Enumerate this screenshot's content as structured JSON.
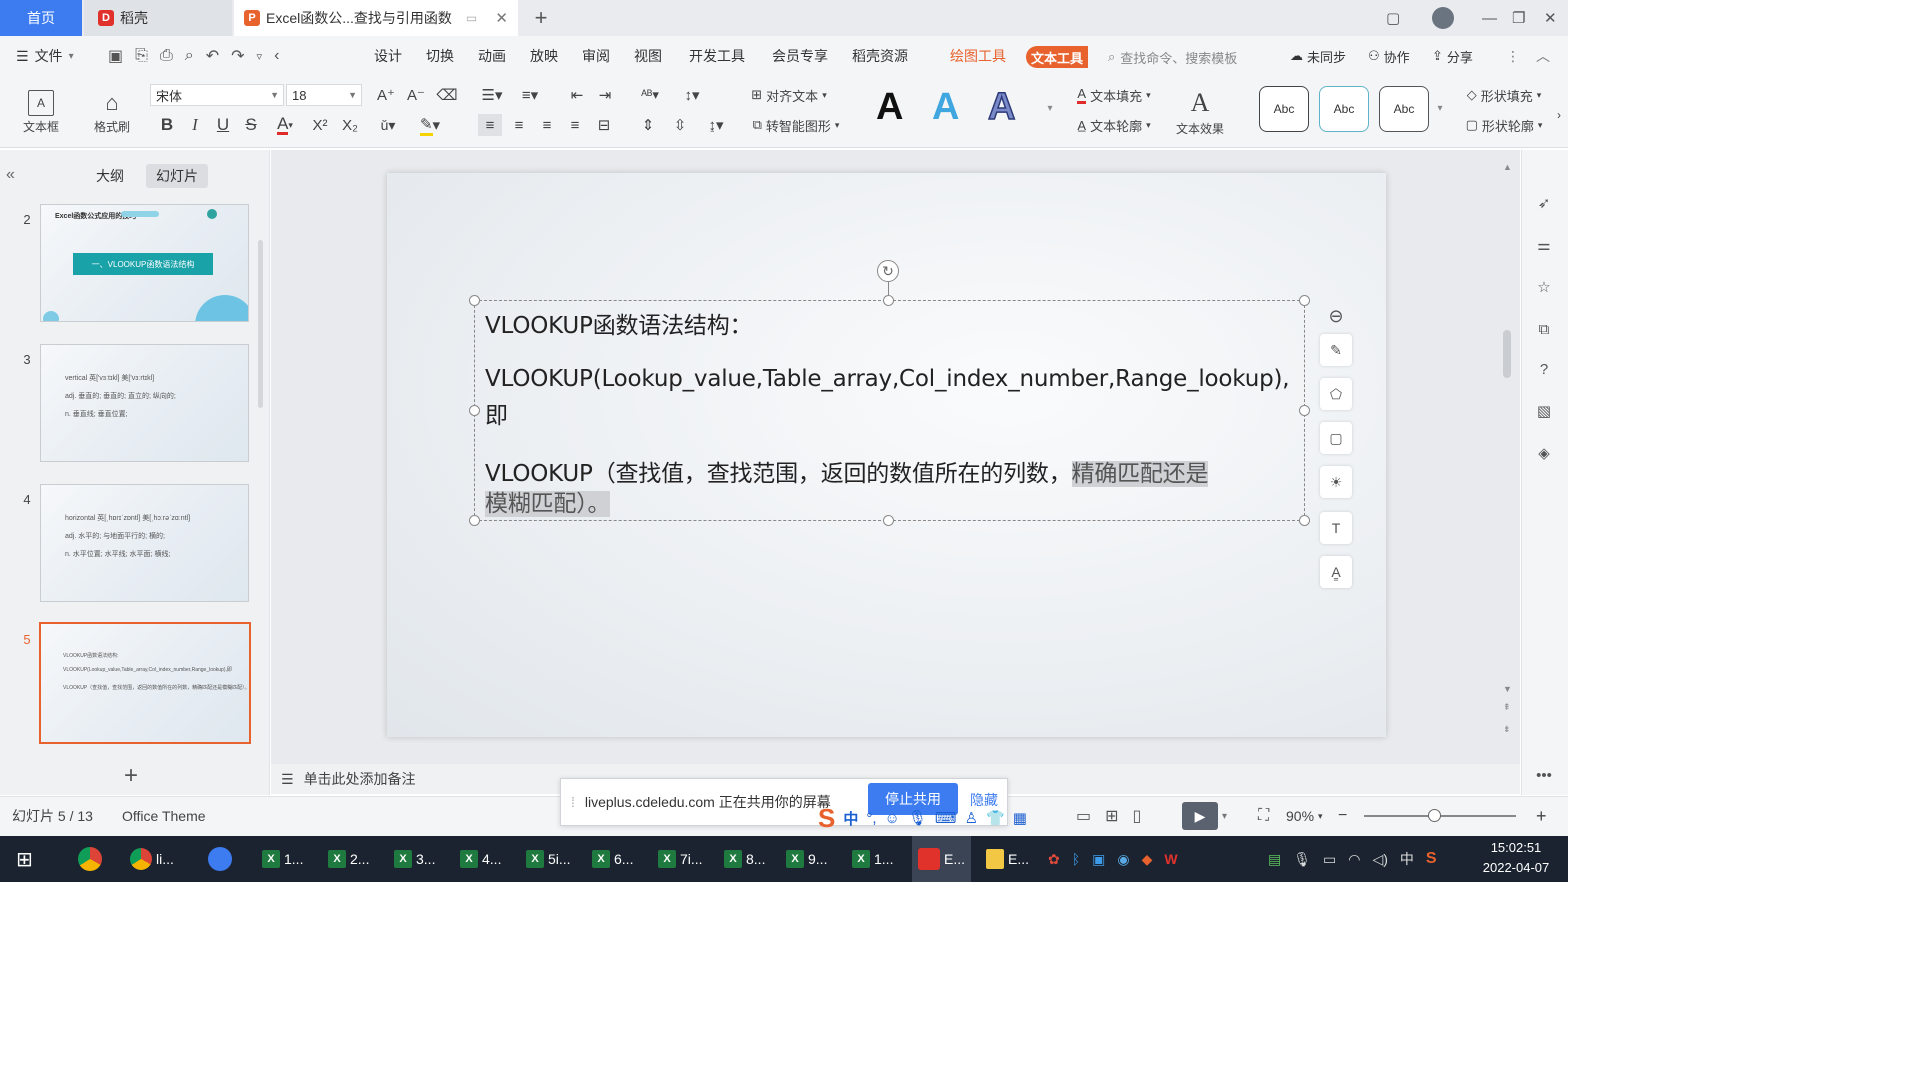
{
  "tabs": {
    "home": "首页",
    "daoke": "稻壳",
    "doc": "Excel函数公...查找与引用函数"
  },
  "menu": {
    "file": "文件",
    "items": [
      "设计",
      "切换",
      "动画",
      "放映",
      "审阅",
      "视图",
      "开发工具",
      "会员专享",
      "稻壳资源"
    ],
    "drawing_tools": "绘图工具",
    "text_tools": "文本工具",
    "search_placeholder": "查找命令、搜索模板",
    "sync": "未同步",
    "collab": "协作",
    "share": "分享"
  },
  "ribbon": {
    "textbox": "文本框",
    "format_painter": "格式刷",
    "font": "宋体",
    "size": "18",
    "align_text": "对齐文本",
    "smart_shape": "转智能图形",
    "text_fill": "文本填充",
    "text_outline": "文本轮廓",
    "text_effect": "文本效果",
    "shape_fill": "形状填充",
    "shape_outline": "形状轮廓",
    "abc": "Abc",
    "art_letter": "A"
  },
  "left_panel": {
    "outline_tab": "大纲",
    "slides_tab": "幻灯片",
    "thumbs": [
      {
        "num": "2",
        "title": "一、VLOOKUP函数语法结构",
        "header": "Excel函数公式应用的技巧"
      },
      {
        "num": "3",
        "lines": [
          "vertical  英['vɜːtɪkl]  美['vɜːrtɪkl]",
          "adj.    垂直的; 垂直的; 直立的; 纵向的;",
          "n.      垂直线; 垂直位置;"
        ]
      },
      {
        "num": "4",
        "lines": [
          "horizontal  英[ˌhɒrɪˈzɒntl]  美[ˌhɔːrəˈzɑːntl]",
          "adj.   水平的; 与地面平行的; 横的;",
          "n.     水平位置; 水平线; 水平面; 横线;"
        ]
      },
      {
        "num": "5",
        "lines": [
          "VLOOKUP函数语法结构:",
          "VLOOKUP(Lookup_value,Table_array,Col_index_number,Range_lookup),即",
          "VLOOKUP（查找值，查找范围，返回的数值所在的列数，精确匹配还是模糊匹配）。"
        ]
      }
    ]
  },
  "slide": {
    "line1": "VLOOKUP函数语法结构：",
    "line2": "VLOOKUP(Lookup_value,Table_array,Col_index_number,Range_lookup),",
    "line3": "即",
    "line4_plain": "VLOOKUP（查找值，查找范围，返回的数值所在的列数，",
    "line4_highlight": "精确匹配还是",
    "line5_highlight": "模糊匹配）。"
  },
  "notes": {
    "placeholder": "单击此处添加备注"
  },
  "status": {
    "slide_counter": "幻灯片 5 / 13",
    "theme": "Office Theme",
    "zoom": "90%",
    "share_text": "liveplus.cdeledu.com 正在共用你的屏幕",
    "stop_share": "停止共用",
    "hide": "隐藏"
  },
  "taskbar": {
    "items": [
      "li...",
      "1...",
      "2...",
      "3...",
      "4...",
      "5i...",
      "6...",
      "7i...",
      "8...",
      "9...",
      "1...",
      "E...",
      "E..."
    ],
    "ime_lang": "中",
    "time": "15:02:51",
    "date": "2022-04-07",
    "tray_lang": "中"
  },
  "colors": {
    "accent_blue": "#3d7cf0",
    "accent_orange": "#e8622d",
    "taskbar": "#1b2330"
  }
}
